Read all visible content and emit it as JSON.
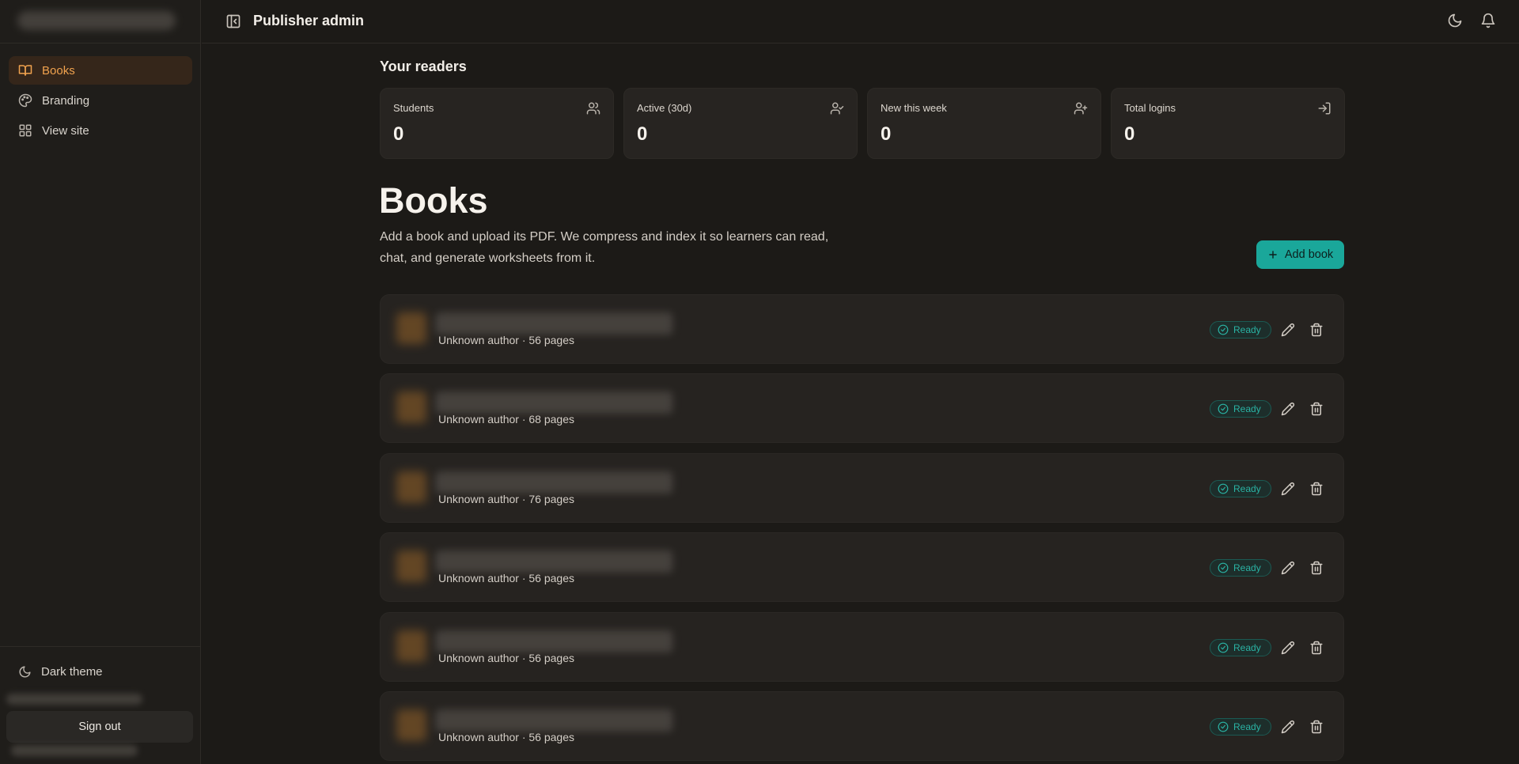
{
  "header": {
    "title": "Publisher admin"
  },
  "sidebar": {
    "items": [
      {
        "label": "Books",
        "icon": "book-open-icon",
        "active": true
      },
      {
        "label": "Branding",
        "icon": "palette-icon",
        "active": false
      },
      {
        "label": "View site",
        "icon": "grid-icon",
        "active": false
      }
    ],
    "theme_label": "Dark theme",
    "signout_label": "Sign out"
  },
  "readers": {
    "title": "Your readers",
    "stats": [
      {
        "label": "Students",
        "value": "0",
        "icon": "users-icon"
      },
      {
        "label": "Active (30d)",
        "value": "0",
        "icon": "user-check-icon"
      },
      {
        "label": "New this week",
        "value": "0",
        "icon": "user-plus-icon"
      },
      {
        "label": "Total logins",
        "value": "0",
        "icon": "log-in-icon"
      }
    ]
  },
  "books": {
    "heading": "Books",
    "description": "Add a book and upload its PDF. We compress and index it so learners can read, chat, and generate worksheets from it.",
    "add_label": "Add book",
    "rows": [
      {
        "meta": "Unknown author · 56 pages",
        "status": "Ready"
      },
      {
        "meta": "Unknown author · 68 pages",
        "status": "Ready"
      },
      {
        "meta": "Unknown author · 76 pages",
        "status": "Ready"
      },
      {
        "meta": "Unknown author · 56 pages",
        "status": "Ready"
      },
      {
        "meta": "Unknown author · 56 pages",
        "status": "Ready"
      },
      {
        "meta": "Unknown author · 56 pages",
        "status": "Ready"
      }
    ]
  },
  "colors": {
    "accent": "#f0a24e",
    "primary_button": "#1aa79a",
    "status_ready": "#2ab3a4",
    "background": "#1c1a17"
  }
}
